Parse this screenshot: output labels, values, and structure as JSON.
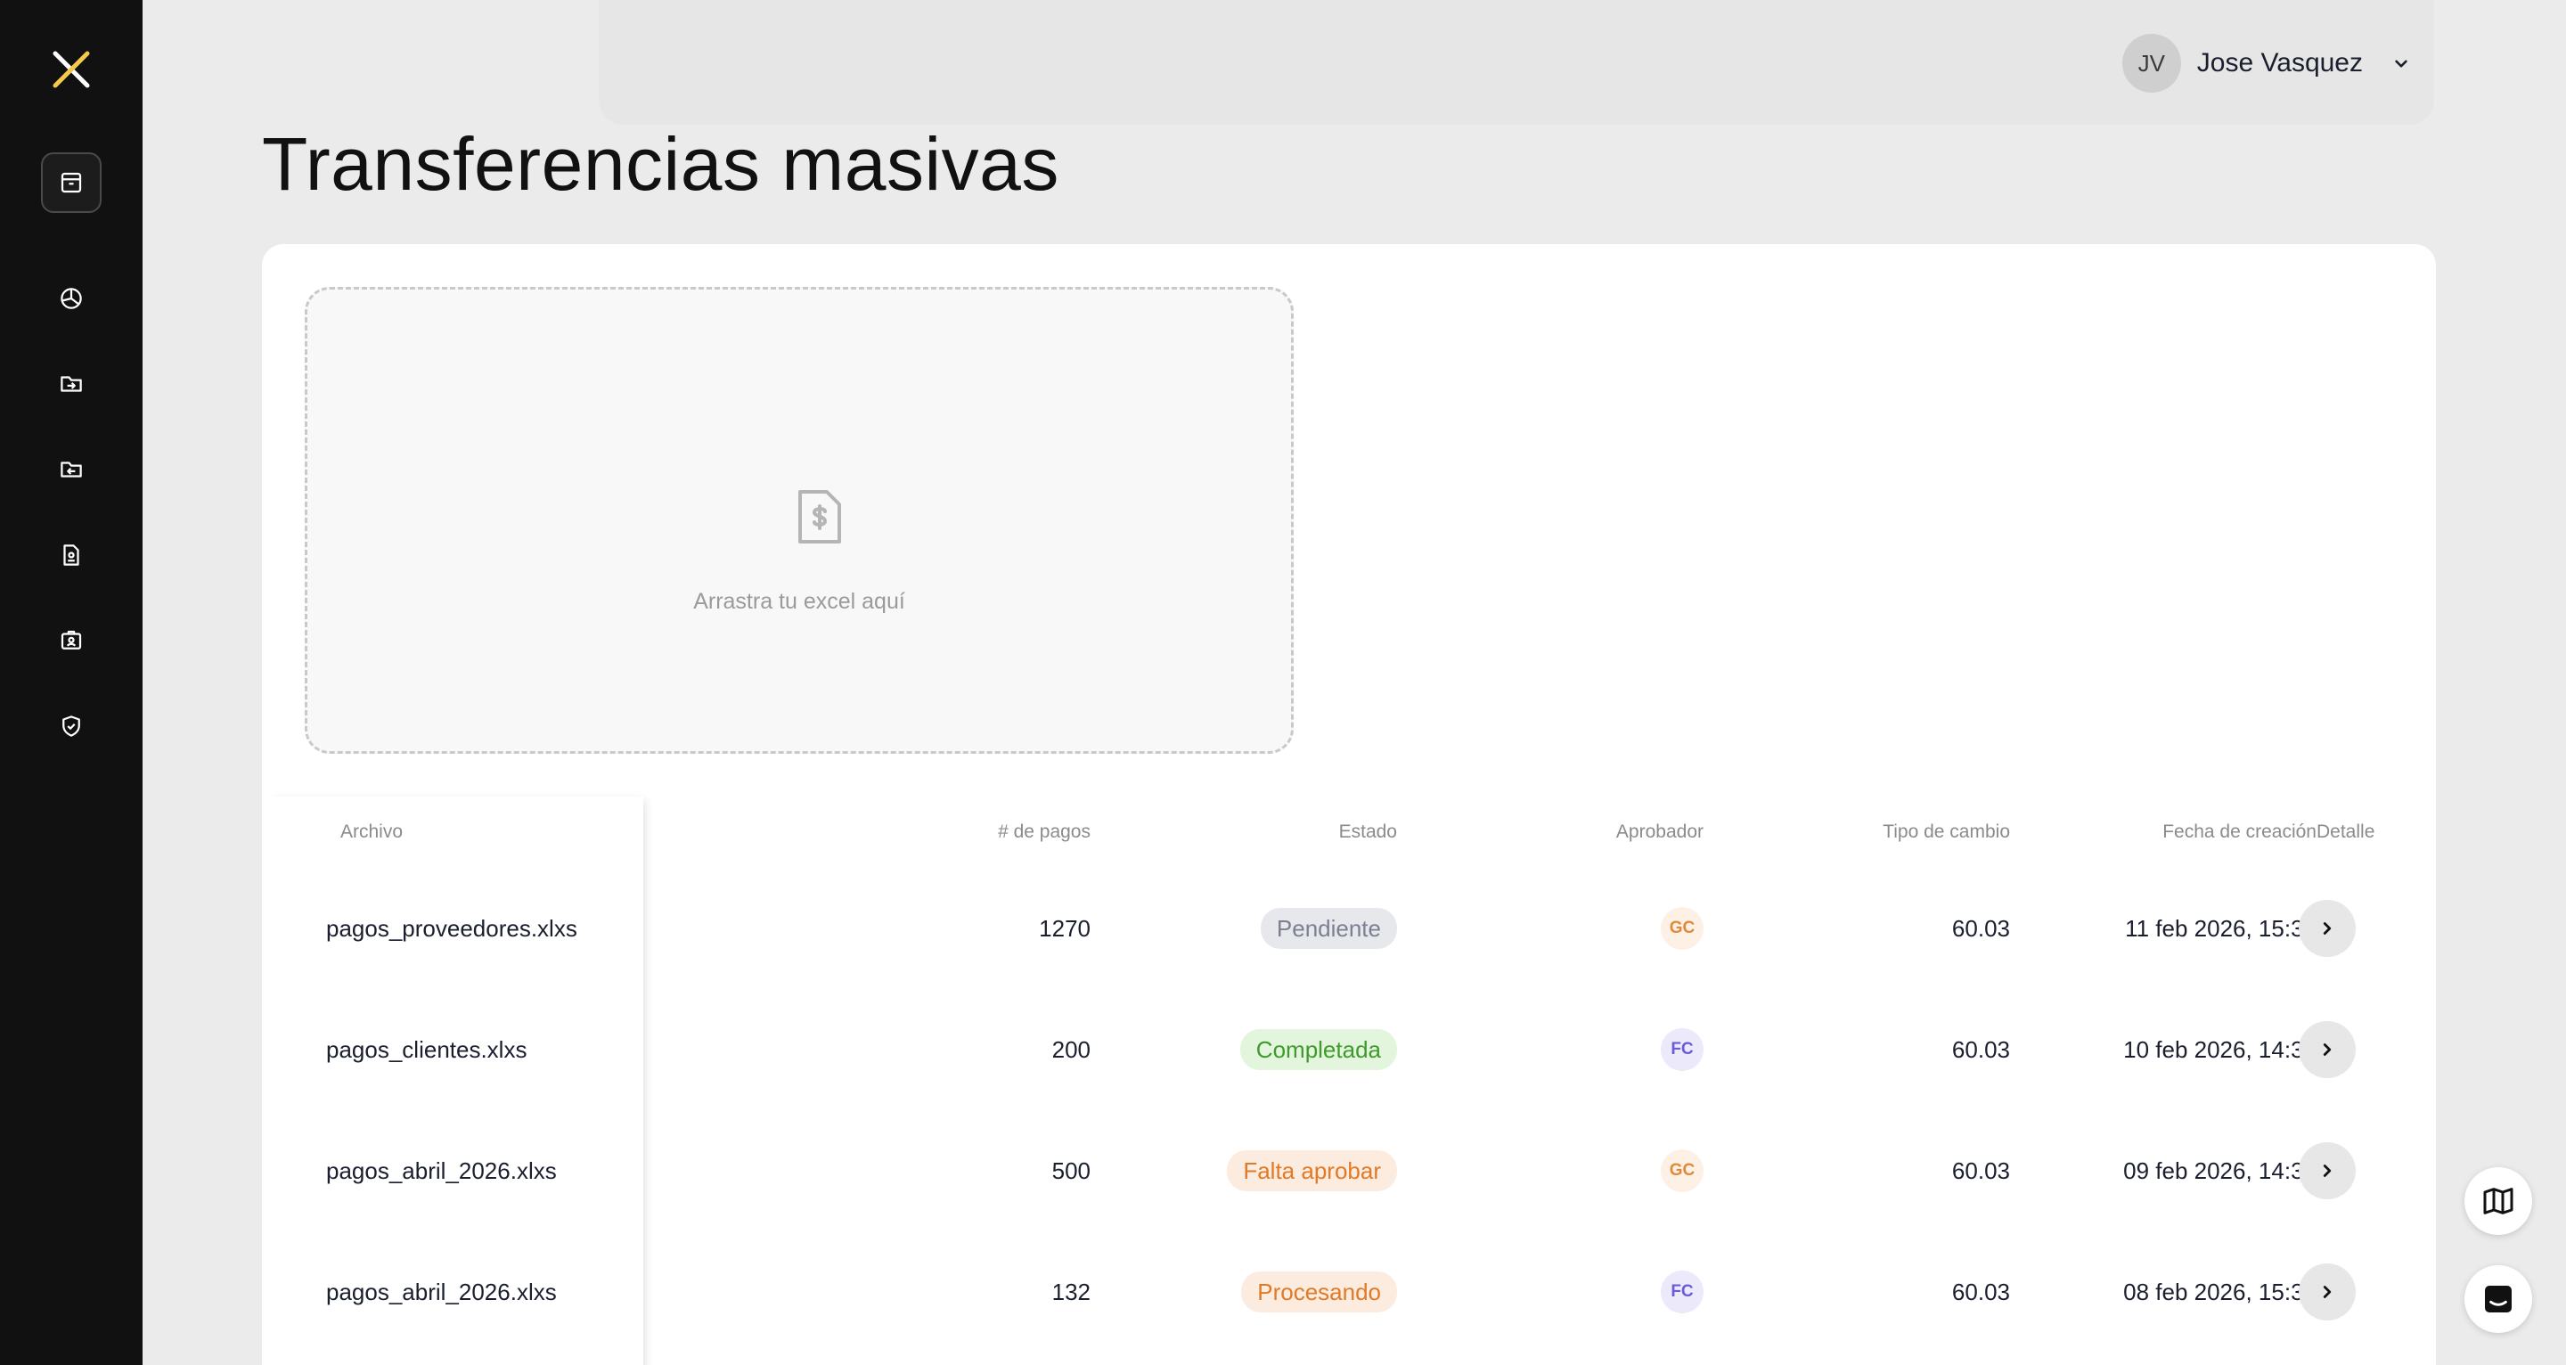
{
  "header": {
    "user_initials": "JV",
    "user_name": "Jose Vasquez"
  },
  "page": {
    "title": "Transferencias masivas"
  },
  "dropzone": {
    "text": "Arrastra tu excel aquí"
  },
  "table": {
    "columns": [
      "Archivo",
      "# de pagos",
      "Estado",
      "Aprobador",
      "Tipo de cambio",
      "Fecha de creación",
      "Detalle"
    ],
    "rows": [
      {
        "archivo": "pagos_proveedores.xlxs",
        "pagos": "1270",
        "estado": "Pendiente",
        "aprobador": "GC",
        "tipo_cambio": "60.03",
        "fecha": "11 feb 2026, 15:30"
      },
      {
        "archivo": "pagos_clientes.xlxs",
        "pagos": "200",
        "estado": "Completada",
        "aprobador": "FC",
        "tipo_cambio": "60.03",
        "fecha": "10 feb 2026, 14:35"
      },
      {
        "archivo": "pagos_abril_2026.xlxs",
        "pagos": "500",
        "estado": "Falta aprobar",
        "aprobador": "GC",
        "tipo_cambio": "60.03",
        "fecha": "09 feb 2026, 14:35"
      },
      {
        "archivo": "pagos_abril_2026.xlxs",
        "pagos": "132",
        "estado": "Procesando",
        "aprobador": "FC",
        "tipo_cambio": "60.03",
        "fecha": "08 feb 2026, 15:30"
      }
    ]
  },
  "status_colors": {
    "Pendiente": {
      "bg": "#e6e8ec",
      "fg": "#7b8190"
    },
    "Completada": {
      "bg": "#e3f5dc",
      "fg": "#3e9a2c"
    },
    "Falta aprobar": {
      "bg": "#fcebdf",
      "fg": "#e07a26"
    },
    "Procesando": {
      "bg": "#fcebdf",
      "fg": "#e07a26"
    }
  },
  "approver_colors": {
    "GC": {
      "bg": "#fdf1e6",
      "fg": "#e08a3c"
    },
    "FC": {
      "bg": "#ece9fb",
      "fg": "#6a5bd6"
    }
  },
  "icons": {
    "logo": "x-logo",
    "nav": [
      "archive-icon",
      "pie-chart-icon",
      "folder-in-icon",
      "folder-out-icon",
      "document-user-icon",
      "id-card-icon",
      "shield-check-icon"
    ],
    "detail": "chevron-right-icon",
    "fab": [
      "map-icon",
      "chat-icon"
    ]
  }
}
